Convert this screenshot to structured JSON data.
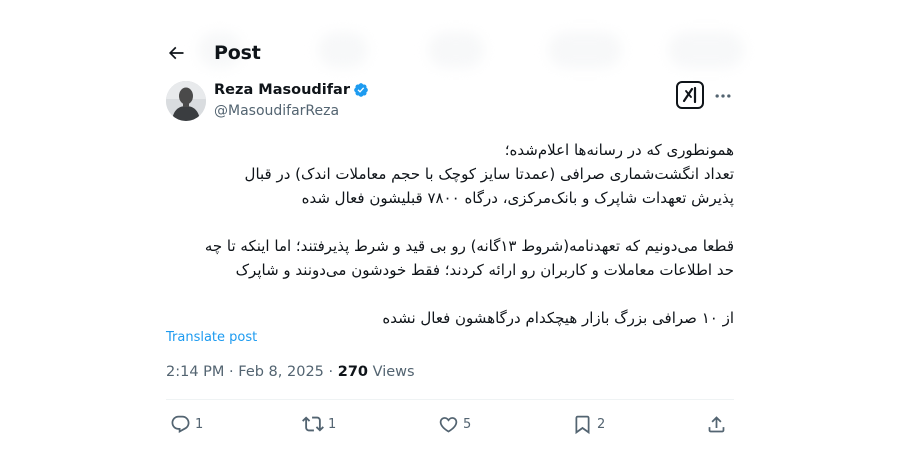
{
  "header": {
    "title": "Post"
  },
  "author": {
    "name": "Reza Masoudifar",
    "handle": "@MasoudifarReza"
  },
  "tweet": {
    "paragraphs": [
      [
        "همونطوری که در رسانه‌ها اعلام‌شده؛",
        "تعداد انگشت‌شماری صرافی (عمدتا سایز کوچک با حجم معاملات اندک) در قبال",
        "پذیرش تعهدات شاپرک و بانک‌مرکزی، درگاه ۷۸۰۰ قبلیشون فعال شده"
      ],
      [
        "قطعا می‌دونیم که تعهدنامه(شروط ۱۳گانه) رو بی قید و شرط پذیرفتند؛ اما اینکه تا چه",
        "حد اطلاعات معاملات و کاربران رو ارائه کردند؛ فقط خودشون می‌دونند و شاپرک"
      ],
      [
        "از ۱۰ صرافی بزرگ بازار هیچکدام درگاهشون فعال نشده"
      ]
    ],
    "translate_label": "Translate post",
    "time": "2:14 PM",
    "separator": "·",
    "date": "Feb 8, 2025",
    "views_count": "270",
    "views_label": "Views"
  },
  "actions": {
    "replies": "1",
    "reposts": "1",
    "likes": "5",
    "bookmarks": "2"
  },
  "icons": {
    "back": "arrow-left-icon",
    "verified": "verified-badge-icon",
    "grok": "grok-icon",
    "more": "more-horizontal-icon",
    "reply": "reply-icon",
    "repost": "repost-icon",
    "like": "heart-icon",
    "bookmark": "bookmark-icon",
    "share": "share-icon"
  },
  "colors": {
    "accent": "#1d9bf0",
    "text": "#0f1419",
    "secondary": "#536471",
    "divider": "#eff3f4"
  }
}
